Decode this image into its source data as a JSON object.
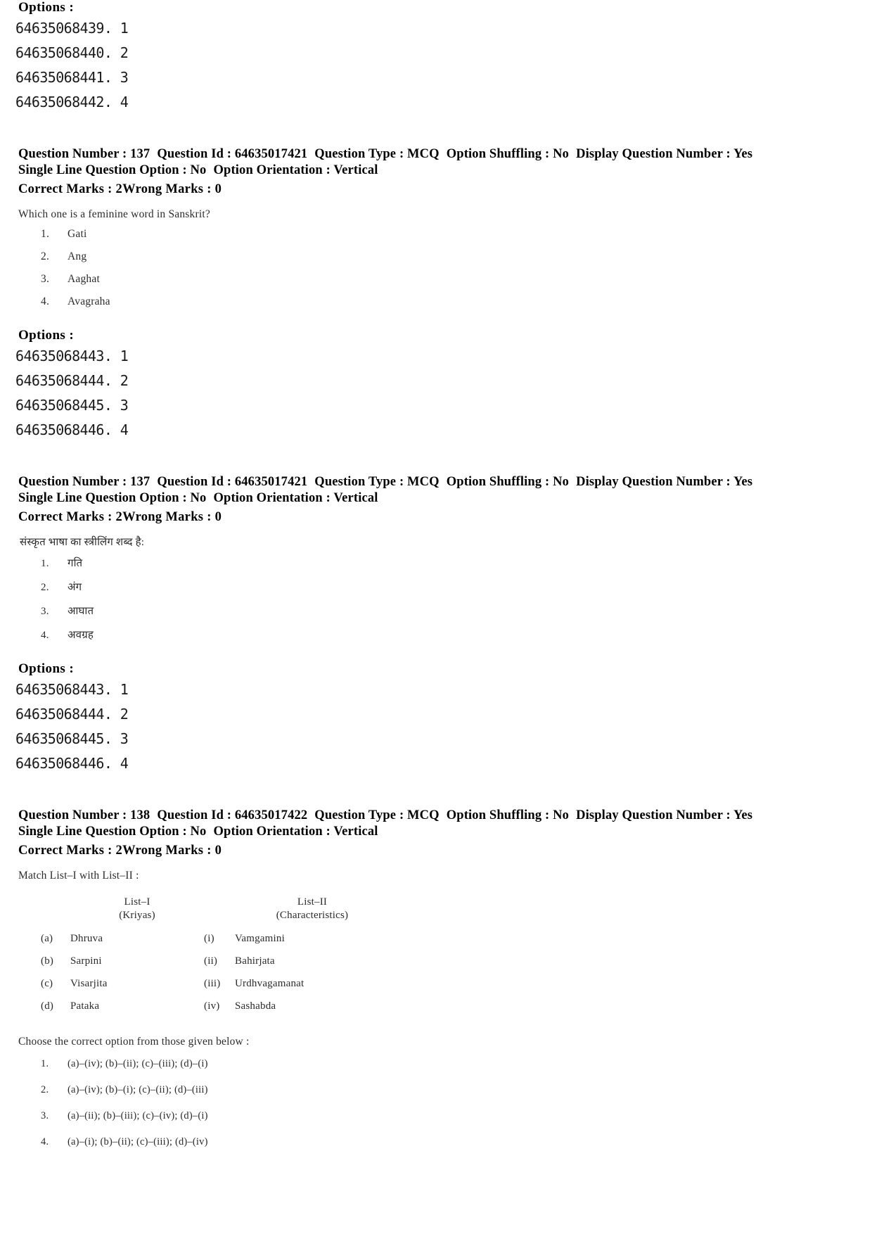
{
  "labels": {
    "options": "Options :",
    "question_number": "Question Number :",
    "question_id": "Question Id :",
    "question_type": "Question Type :",
    "option_shuffling": "Option Shuffling :",
    "display_question_number": "Display Question Number :",
    "single_line_question_option": "Single Line Question Option :",
    "option_orientation": "Option Orientation :",
    "correct_marks": "Correct Marks :",
    "wrong_marks": "Wrong Marks :"
  },
  "blocks": [
    {
      "id": "options-top",
      "options_label": "Options :",
      "option_ids": [
        "64635068439. 1",
        "64635068440. 2",
        "64635068441. 3",
        "64635068442. 4"
      ]
    },
    {
      "id": "q137-en",
      "meta": {
        "question_number": "137",
        "question_id": "64635017421",
        "question_type": "MCQ",
        "option_shuffling": "No",
        "display_question_number": "Yes",
        "single_line_question_option": "No",
        "option_orientation": "Vertical",
        "correct_marks": "2",
        "wrong_marks": "0"
      },
      "question_text": "Which one is a feminine word in Sanskrit?",
      "choices": [
        {
          "num": "1.",
          "text": "Gati"
        },
        {
          "num": "2.",
          "text": "Ang"
        },
        {
          "num": "3.",
          "text": "Aaghat"
        },
        {
          "num": "4.",
          "text": "Avagraha"
        }
      ],
      "options_label": "Options :",
      "option_ids": [
        "64635068443. 1",
        "64635068444. 2",
        "64635068445. 3",
        "64635068446. 4"
      ]
    },
    {
      "id": "q137-hi",
      "meta": {
        "question_number": "137",
        "question_id": "64635017421",
        "question_type": "MCQ",
        "option_shuffling": "No",
        "display_question_number": "Yes",
        "single_line_question_option": "No",
        "option_orientation": "Vertical",
        "correct_marks": "2",
        "wrong_marks": "0"
      },
      "question_text": "संस्कृत भाषा का स्त्रीलिंग शब्द है:",
      "choices": [
        {
          "num": "1.",
          "text": "गति"
        },
        {
          "num": "2.",
          "text": "अंग"
        },
        {
          "num": "3.",
          "text": "आघात"
        },
        {
          "num": "4.",
          "text": "अवग्रह"
        }
      ],
      "options_label": "Options :",
      "option_ids": [
        "64635068443. 1",
        "64635068444. 2",
        "64635068445. 3",
        "64635068446. 4"
      ]
    },
    {
      "id": "q138-en",
      "meta": {
        "question_number": "138",
        "question_id": "64635017422",
        "question_type": "MCQ",
        "option_shuffling": "No",
        "display_question_number": "Yes",
        "single_line_question_option": "No",
        "option_orientation": "Vertical",
        "correct_marks": "2",
        "wrong_marks": "0"
      },
      "match_intro": "Match List–I with List–II :",
      "list_headers": {
        "left_title": "List–I",
        "left_subtitle": "(Kriyas)",
        "right_title": "List–II",
        "right_subtitle": "(Characteristics)"
      },
      "match_rows": [
        {
          "left_key": "(a)",
          "left_val": "Dhruva",
          "right_key": "(i)",
          "right_val": "Vamgamini"
        },
        {
          "left_key": "(b)",
          "left_val": "Sarpini",
          "right_key": "(ii)",
          "right_val": "Bahirjata"
        },
        {
          "left_key": "(c)",
          "left_val": "Visarjita",
          "right_key": "(iii)",
          "right_val": "Urdhvagamanat"
        },
        {
          "left_key": "(d)",
          "left_val": "Pataka",
          "right_key": "(iv)",
          "right_val": "Sashabda"
        }
      ],
      "choose_text": "Choose the correct option from those given below :",
      "answers": [
        {
          "num": "1.",
          "text": "(a)–(iv); (b)–(ii); (c)–(iii); (d)–(i)"
        },
        {
          "num": "2.",
          "text": "(a)–(iv); (b)–(i); (c)–(ii); (d)–(iii)"
        },
        {
          "num": "3.",
          "text": "(a)–(ii); (b)–(iii); (c)–(iv); (d)–(i)"
        },
        {
          "num": "4.",
          "text": "(a)–(i); (b)–(ii); (c)–(iii); (d)–(iv)"
        }
      ]
    }
  ]
}
